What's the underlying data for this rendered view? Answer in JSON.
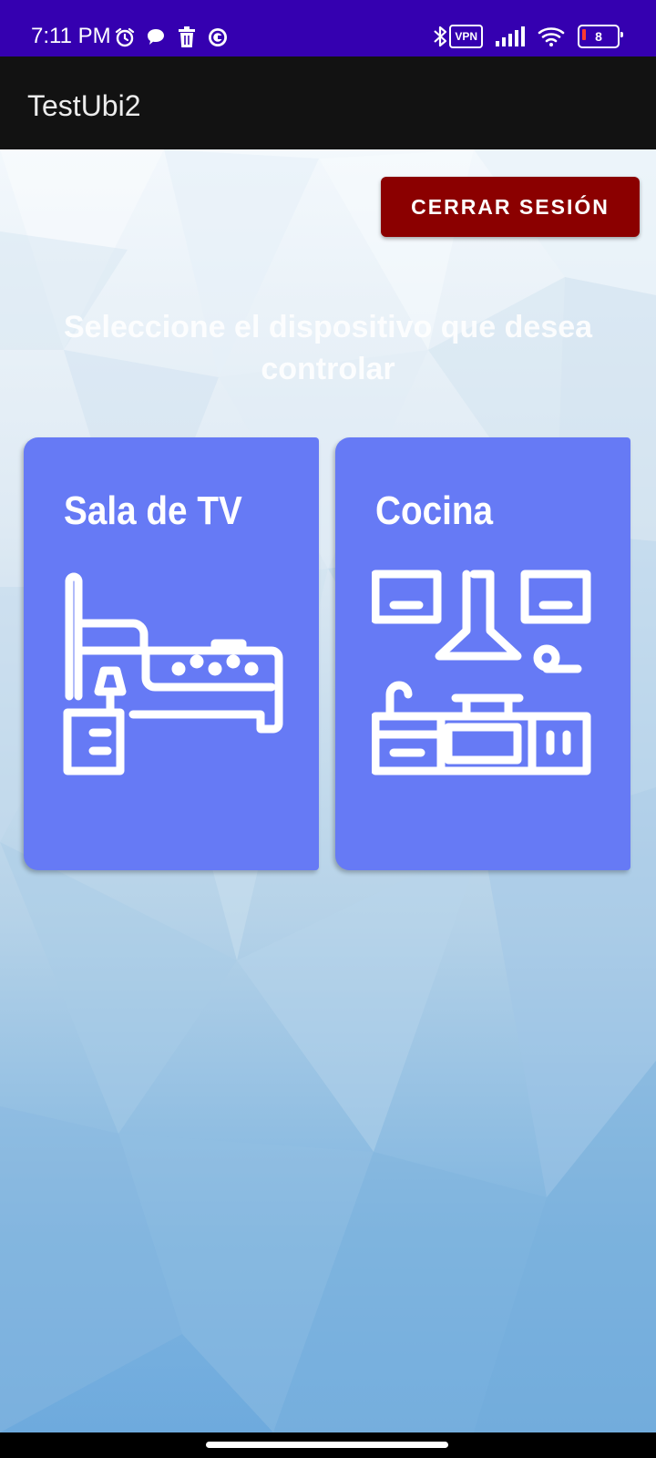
{
  "status_bar": {
    "time": "7:11 PM",
    "left_icons": [
      "alarm-icon",
      "chat-bubble-icon",
      "trash-icon",
      "browser-icon"
    ],
    "right_icons": [
      "bluetooth-icon",
      "vpn-icon",
      "signal-icon",
      "wifi-icon",
      "battery-icon"
    ],
    "vpn_label": "VPN",
    "battery_level": "8",
    "background_color": "#3500b0"
  },
  "app_bar": {
    "title": "TestUbi2",
    "background_color": "#121212"
  },
  "main": {
    "logout_label": "CERRAR SESIÓN",
    "logout_color": "#8b0000",
    "prompt": "Seleccione el dispositivo que desea controlar",
    "cards": [
      {
        "title": "Sala de TV",
        "icon": "living-room-icon"
      },
      {
        "title": "Cocina",
        "icon": "kitchen-icon"
      }
    ],
    "card_color": "#667af5"
  }
}
